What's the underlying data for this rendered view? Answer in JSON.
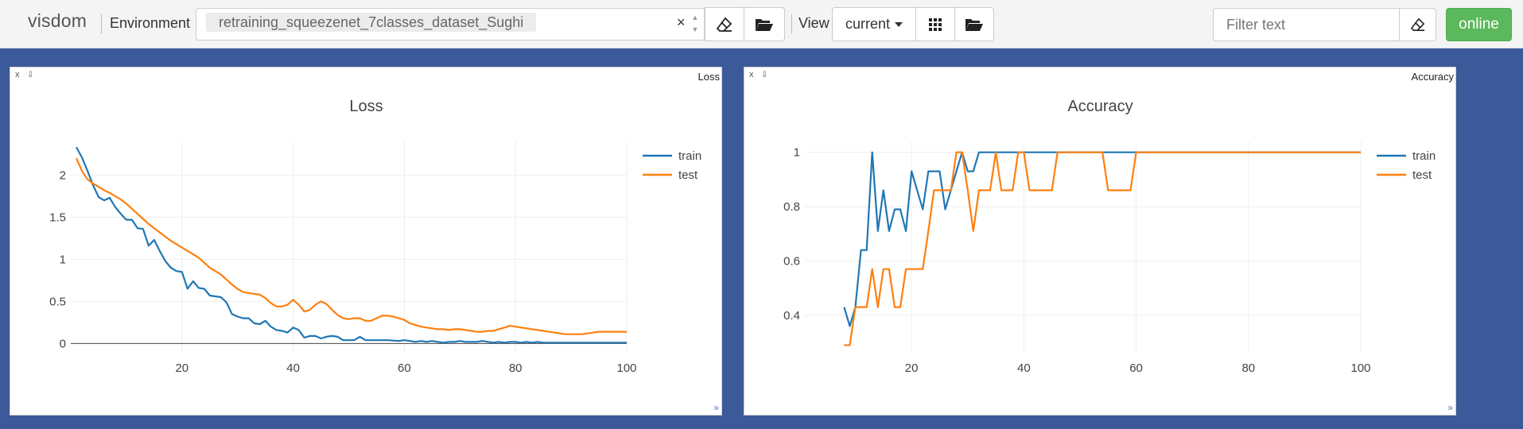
{
  "topbar": {
    "brand": "visdom",
    "environment_label": "Environment",
    "environment_value": "retraining_squeezenet_7classes_dataset_Sughi",
    "clear_symbol": "×",
    "view_label": "View",
    "view_selected": "current",
    "filter_placeholder": "Filter text",
    "online_label": "online",
    "icons": [
      "eraser-icon",
      "folder-open-icon",
      "grid-icon",
      "folder-open-icon",
      "eraser-icon"
    ]
  },
  "panes": [
    {
      "pane_title": "Loss",
      "close_symbol": "x",
      "download_symbol": "⇩",
      "resize_symbol": "»",
      "chart_data": {
        "type": "line",
        "title": "Loss",
        "xlabel": "",
        "ylabel": "",
        "xlim": [
          0,
          100
        ],
        "ylim": [
          -0.1,
          2.4
        ],
        "xticks": [
          20,
          40,
          60,
          80,
          100
        ],
        "yticks": [
          0,
          0.5,
          1,
          1.5,
          2
        ],
        "ytick_labels": [
          "0",
          "0.5",
          "1",
          "1.5",
          "2"
        ],
        "grid": true,
        "legend_position": "top-right",
        "series": [
          {
            "name": "train",
            "color": "#1f77b4",
            "x": [
              1,
              2,
              3,
              4,
              5,
              6,
              7,
              8,
              9,
              10,
              11,
              12,
              13,
              14,
              15,
              16,
              17,
              18,
              19,
              20,
              21,
              22,
              23,
              24,
              25,
              26,
              27,
              28,
              29,
              30,
              31,
              32,
              33,
              34,
              35,
              36,
              37,
              38,
              39,
              40,
              41,
              42,
              43,
              44,
              45,
              46,
              47,
              48,
              49,
              50,
              51,
              52,
              53,
              54,
              55,
              56,
              57,
              58,
              59,
              60,
              61,
              62,
              63,
              64,
              65,
              66,
              67,
              68,
              69,
              70,
              71,
              72,
              73,
              74,
              75,
              76,
              77,
              78,
              79,
              80,
              81,
              82,
              83,
              84,
              85,
              86,
              87,
              88,
              89,
              90,
              91,
              92,
              93,
              94,
              95,
              96,
              97,
              98,
              99,
              100
            ],
            "y": [
              2.33,
              2.21,
              2.05,
              1.88,
              1.74,
              1.7,
              1.73,
              1.62,
              1.54,
              1.47,
              1.47,
              1.37,
              1.36,
              1.16,
              1.23,
              1.1,
              0.98,
              0.9,
              0.86,
              0.85,
              0.65,
              0.74,
              0.66,
              0.65,
              0.57,
              0.56,
              0.55,
              0.49,
              0.35,
              0.32,
              0.3,
              0.3,
              0.24,
              0.23,
              0.27,
              0.2,
              0.16,
              0.15,
              0.13,
              0.19,
              0.16,
              0.07,
              0.09,
              0.09,
              0.06,
              0.08,
              0.09,
              0.08,
              0.04,
              0.04,
              0.04,
              0.08,
              0.04,
              0.04,
              0.04,
              0.04,
              0.04,
              0.035,
              0.03,
              0.04,
              0.03,
              0.02,
              0.03,
              0.02,
              0.03,
              0.02,
              0.01,
              0.02,
              0.02,
              0.03,
              0.02,
              0.02,
              0.02,
              0.03,
              0.02,
              0.01,
              0.02,
              0.01,
              0.02,
              0.02,
              0.01,
              0.02,
              0.01,
              0.02,
              0.01,
              0.01,
              0.01,
              0.01,
              0.01,
              0.01,
              0.01,
              0.01,
              0.01,
              0.01,
              0.01,
              0.01,
              0.01,
              0.01,
              0.01,
              0.01
            ]
          },
          {
            "name": "test",
            "color": "#ff7f0e",
            "x": [
              1,
              2,
              3,
              4,
              5,
              6,
              7,
              8,
              9,
              10,
              11,
              12,
              13,
              14,
              15,
              16,
              17,
              18,
              19,
              20,
              21,
              22,
              23,
              24,
              25,
              26,
              27,
              28,
              29,
              30,
              31,
              32,
              33,
              34,
              35,
              36,
              37,
              38,
              39,
              40,
              41,
              42,
              43,
              44,
              45,
              46,
              47,
              48,
              49,
              50,
              51,
              52,
              53,
              54,
              55,
              56,
              57,
              58,
              59,
              60,
              61,
              62,
              63,
              64,
              65,
              66,
              67,
              68,
              69,
              70,
              71,
              72,
              73,
              74,
              75,
              76,
              77,
              78,
              79,
              80,
              81,
              82,
              83,
              84,
              85,
              86,
              87,
              88,
              89,
              90,
              91,
              92,
              93,
              94,
              95,
              96,
              97,
              98,
              99,
              100
            ],
            "y": [
              2.2,
              2.05,
              1.95,
              1.9,
              1.86,
              1.82,
              1.79,
              1.75,
              1.71,
              1.66,
              1.6,
              1.54,
              1.48,
              1.42,
              1.37,
              1.32,
              1.27,
              1.22,
              1.18,
              1.14,
              1.1,
              1.06,
              1.02,
              0.96,
              0.9,
              0.86,
              0.82,
              0.76,
              0.7,
              0.65,
              0.61,
              0.6,
              0.59,
              0.58,
              0.54,
              0.48,
              0.44,
              0.44,
              0.46,
              0.52,
              0.46,
              0.38,
              0.4,
              0.46,
              0.5,
              0.47,
              0.4,
              0.34,
              0.3,
              0.29,
              0.3,
              0.3,
              0.27,
              0.27,
              0.3,
              0.33,
              0.33,
              0.32,
              0.3,
              0.28,
              0.24,
              0.22,
              0.2,
              0.19,
              0.18,
              0.17,
              0.17,
              0.16,
              0.17,
              0.17,
              0.16,
              0.15,
              0.14,
              0.14,
              0.15,
              0.15,
              0.17,
              0.19,
              0.21,
              0.2,
              0.19,
              0.18,
              0.17,
              0.16,
              0.15,
              0.14,
              0.13,
              0.12,
              0.11,
              0.11,
              0.11,
              0.11,
              0.12,
              0.13,
              0.14,
              0.14,
              0.14,
              0.14,
              0.14,
              0.14
            ]
          }
        ]
      }
    },
    {
      "pane_title": "Accuracy",
      "close_symbol": "x",
      "download_symbol": "⇩",
      "resize_symbol": "»",
      "chart_data": {
        "type": "line",
        "title": "Accuracy",
        "xlabel": "",
        "ylabel": "",
        "xlim": [
          1,
          100
        ],
        "ylim": [
          0.265,
          1.04
        ],
        "xticks": [
          20,
          40,
          60,
          80,
          100
        ],
        "yticks": [
          0.4,
          0.6,
          0.8,
          1
        ],
        "ytick_labels": [
          "0.4",
          "0.6",
          "0.8",
          "1"
        ],
        "grid": true,
        "legend_position": "top-right",
        "series": [
          {
            "name": "train",
            "color": "#1f77b4",
            "x": [
              8,
              9,
              10,
              11,
              12,
              13,
              14,
              15,
              16,
              17,
              18,
              19,
              20,
              21,
              22,
              23,
              24,
              25,
              26,
              27,
              28,
              29,
              30,
              31,
              32,
              33,
              34,
              35,
              36,
              37,
              38,
              39,
              40,
              41,
              42,
              43,
              44,
              45,
              46,
              47,
              48,
              49,
              50,
              51,
              52,
              53,
              54,
              55,
              56,
              57,
              58,
              59,
              60,
              61,
              62,
              63,
              64,
              65,
              66,
              67,
              68,
              69,
              70,
              71,
              72,
              73,
              74,
              75,
              76,
              77,
              78,
              79,
              80,
              81,
              82,
              83,
              84,
              85,
              86,
              87,
              88,
              89,
              90,
              91,
              92,
              93,
              94,
              95,
              96,
              97,
              98,
              99,
              100
            ],
            "y": [
              0.43,
              0.36,
              0.43,
              0.64,
              0.64,
              1,
              0.71,
              0.86,
              0.71,
              0.79,
              0.79,
              0.71,
              0.93,
              0.86,
              0.79,
              0.93,
              0.93,
              0.93,
              0.79,
              0.86,
              0.93,
              1,
              0.93,
              0.93,
              1,
              1,
              1,
              1,
              1,
              1,
              1,
              1,
              1,
              1,
              1,
              1,
              1,
              1,
              1,
              1,
              1,
              1,
              1,
              1,
              1,
              1,
              1,
              1,
              1,
              1,
              1,
              1,
              1,
              1,
              1,
              1,
              1,
              1,
              1,
              1,
              1,
              1,
              1,
              1,
              1,
              1,
              1,
              1,
              1,
              1,
              1,
              1,
              1,
              1,
              1,
              1,
              1,
              1,
              1,
              1,
              1,
              1,
              1,
              1,
              1,
              1,
              1,
              1,
              1,
              1,
              1,
              1,
              1
            ]
          },
          {
            "name": "test",
            "color": "#ff7f0e",
            "x": [
              8,
              9,
              10,
              11,
              12,
              13,
              14,
              15,
              16,
              17,
              18,
              19,
              20,
              21,
              22,
              23,
              24,
              25,
              26,
              27,
              28,
              29,
              30,
              31,
              32,
              33,
              34,
              35,
              36,
              37,
              38,
              39,
              40,
              41,
              42,
              43,
              44,
              45,
              46,
              47,
              48,
              49,
              50,
              51,
              52,
              53,
              54,
              55,
              56,
              57,
              58,
              59,
              60,
              61,
              62,
              63,
              64,
              65,
              66,
              67,
              68,
              69,
              70,
              71,
              72,
              73,
              74,
              75,
              76,
              77,
              78,
              79,
              80,
              81,
              82,
              83,
              84,
              85,
              86,
              87,
              88,
              89,
              90,
              91,
              92,
              93,
              94,
              95,
              96,
              97,
              98,
              99,
              100
            ],
            "y": [
              0.29,
              0.29,
              0.43,
              0.43,
              0.43,
              0.57,
              0.43,
              0.57,
              0.57,
              0.43,
              0.43,
              0.57,
              0.57,
              0.57,
              0.57,
              0.71,
              0.86,
              0.86,
              0.86,
              0.86,
              1,
              1,
              0.86,
              0.71,
              0.86,
              0.86,
              0.86,
              1,
              0.86,
              0.86,
              0.86,
              1,
              1,
              0.86,
              0.86,
              0.86,
              0.86,
              0.86,
              1,
              1,
              1,
              1,
              1,
              1,
              1,
              1,
              1,
              0.86,
              0.86,
              0.86,
              0.86,
              0.86,
              1,
              1,
              1,
              1,
              1,
              1,
              1,
              1,
              1,
              1,
              1,
              1,
              1,
              1,
              1,
              1,
              1,
              1,
              1,
              1,
              1,
              1,
              1,
              1,
              1,
              1,
              1,
              1,
              1,
              1,
              1,
              1,
              1,
              1,
              1,
              1,
              1,
              1,
              1,
              1,
              1
            ]
          }
        ]
      }
    }
  ]
}
